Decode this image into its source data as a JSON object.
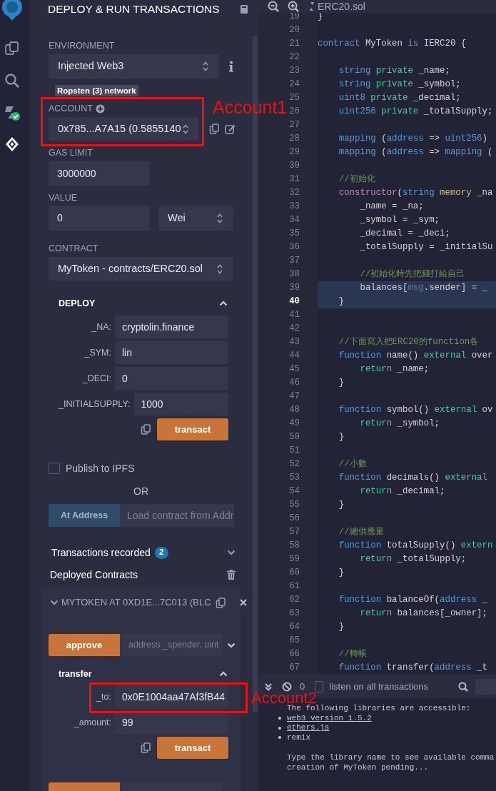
{
  "icon_bar": {
    "items": [
      {
        "kind": "files",
        "selected": false
      },
      {
        "kind": "search",
        "selected": false
      },
      {
        "kind": "compiler",
        "selected": false
      },
      {
        "kind": "deploy",
        "selected": true
      }
    ]
  },
  "panel": {
    "title": "DEPLOY & RUN TRANSACTIONS",
    "environment": {
      "label": "ENVIRONMENT",
      "value": "Injected Web3",
      "network": "Ropsten (3) network"
    },
    "account": {
      "label": "ACCOUNT",
      "value": "0x785...A7A15 (0.5855140"
    },
    "gas_limit": {
      "label": "GAS LIMIT",
      "value": "3000000"
    },
    "value": {
      "label": "VALUE",
      "amount": "0",
      "unit": "Wei"
    },
    "contract": {
      "label": "CONTRACT",
      "value": "MyToken - contracts/ERC20.sol"
    },
    "deploy": {
      "title": "DEPLOY",
      "expanded": true,
      "params": [
        {
          "label": "_NA:",
          "value": "cryptolin.finance"
        },
        {
          "label": "_SYM:",
          "value": "lin"
        },
        {
          "label": "_DECI:",
          "value": "0"
        },
        {
          "label": "_INITIALSUPPLY:",
          "value": "1000"
        }
      ],
      "button": "transact"
    },
    "publish_ipfs": {
      "label": "Publish to IPFS",
      "checked": false
    },
    "or": "OR",
    "at_address": {
      "button": "At Address",
      "placeholder": "Load contract from Addr"
    },
    "transactions_recorded": {
      "label": "Transactions recorded",
      "count": "2"
    },
    "deployed_contracts": {
      "title": "Deployed Contracts",
      "contracts": [
        {
          "title": "MYTOKEN AT 0XD1E...7C013 (BLC",
          "expanded": true,
          "functions": [
            {
              "label": "approve",
              "expanded": false,
              "placeholder": "address _spender, uint"
            },
            {
              "label": "transfer",
              "expanded": true,
              "params": [
                {
                  "label": "_to:",
                  "value": "0x0E1004aa47Af3fB44"
                },
                {
                  "label": "_amount:",
                  "value": "99"
                }
              ],
              "button": "transact"
            },
            {
              "expanded": false
            }
          ]
        }
      ]
    }
  },
  "editor": {
    "tab": "ERC20.sol",
    "lines": [
      {
        "number": "19",
        "highlighted": false,
        "current": false,
        "tokens": [
          {
            "text": "}",
            "kind": "plain"
          }
        ]
      },
      {
        "number": "20",
        "highlighted": false,
        "current": false
      },
      {
        "number": "21",
        "highlighted": false,
        "current": false,
        "tokens": [
          {
            "text": "contract",
            "kind": "keyword"
          },
          {
            "text": " MyToken ",
            "kind": "plain"
          },
          {
            "text": "is",
            "kind": "keyword"
          },
          {
            "text": " IERC20 {",
            "kind": "plain"
          }
        ]
      },
      {
        "number": "22",
        "highlighted": false,
        "current": false
      },
      {
        "number": "23",
        "highlighted": false,
        "current": false,
        "tokens": [
          {
            "text": "    string",
            "kind": "type"
          },
          {
            "text": " private",
            "kind": "modifier"
          },
          {
            "text": " _name;",
            "kind": "plain"
          }
        ]
      },
      {
        "number": "24",
        "highlighted": false,
        "current": false,
        "tokens": [
          {
            "text": "    string",
            "kind": "type"
          },
          {
            "text": " private",
            "kind": "modifier"
          },
          {
            "text": " _symbol;",
            "kind": "plain"
          }
        ]
      },
      {
        "number": "25",
        "highlighted": false,
        "current": false,
        "tokens": [
          {
            "text": "    uint8",
            "kind": "type"
          },
          {
            "text": " private",
            "kind": "modifier"
          },
          {
            "text": " _decimal;",
            "kind": "plain"
          }
        ]
      },
      {
        "number": "26",
        "highlighted": false,
        "current": false,
        "tokens": [
          {
            "text": "    uint256",
            "kind": "type"
          },
          {
            "text": " private",
            "kind": "modifier"
          },
          {
            "text": " _totalSupply;",
            "kind": "plain"
          }
        ]
      },
      {
        "number": "27",
        "highlighted": false,
        "current": false
      },
      {
        "number": "28",
        "highlighted": false,
        "current": false,
        "tokens": [
          {
            "text": "    mapping",
            "kind": "type"
          },
          {
            "text": " (",
            "kind": "plain"
          },
          {
            "text": "address",
            "kind": "type"
          },
          {
            "text": " => ",
            "kind": "plain"
          },
          {
            "text": "uint256",
            "kind": "type"
          },
          {
            "text": ")",
            "kind": "plain"
          }
        ]
      },
      {
        "number": "29",
        "highlighted": false,
        "current": false,
        "tokens": [
          {
            "text": "    mapping",
            "kind": "type"
          },
          {
            "text": " (",
            "kind": "plain"
          },
          {
            "text": "address",
            "kind": "type"
          },
          {
            "text": " => ",
            "kind": "plain"
          },
          {
            "text": "mapping",
            "kind": "type"
          },
          {
            "text": " (",
            "kind": "plain"
          }
        ]
      },
      {
        "number": "30",
        "highlighted": false,
        "current": false
      },
      {
        "number": "31",
        "highlighted": false,
        "current": false,
        "tokens": [
          {
            "text": "    //初始化",
            "kind": "comment"
          }
        ]
      },
      {
        "number": "32",
        "highlighted": false,
        "current": false,
        "tokens": [
          {
            "text": "    constructor",
            "kind": "special"
          },
          {
            "text": "(",
            "kind": "plain"
          },
          {
            "text": "string",
            "kind": "type"
          },
          {
            "text": " memory",
            "kind": "storage"
          },
          {
            "text": " _na",
            "kind": "plain"
          }
        ]
      },
      {
        "number": "33",
        "highlighted": false,
        "current": false,
        "tokens": [
          {
            "text": "        _name = _na;",
            "kind": "plain"
          }
        ]
      },
      {
        "number": "34",
        "highlighted": false,
        "current": false,
        "tokens": [
          {
            "text": "        _symbol = _sym;",
            "kind": "plain"
          }
        ]
      },
      {
        "number": "35",
        "highlighted": false,
        "current": false,
        "tokens": [
          {
            "text": "        _decimal = _deci;",
            "kind": "plain"
          }
        ]
      },
      {
        "number": "36",
        "highlighted": false,
        "current": false,
        "tokens": [
          {
            "text": "        _totalSupply = _initialSu",
            "kind": "plain"
          }
        ]
      },
      {
        "number": "37",
        "highlighted": false,
        "current": false
      },
      {
        "number": "38",
        "highlighted": false,
        "current": false,
        "tokens": [
          {
            "text": "        //初始化時先把錢打給自己",
            "kind": "comment"
          }
        ]
      },
      {
        "number": "39",
        "highlighted": true,
        "current": false,
        "tokens": [
          {
            "text": "        balances[",
            "kind": "plain"
          },
          {
            "text": "msg",
            "kind": "builtin"
          },
          {
            "text": ".sender] = _",
            "kind": "plain"
          }
        ]
      },
      {
        "number": "40",
        "highlighted": true,
        "current": true,
        "tokens": [
          {
            "text": "    }",
            "kind": "plain"
          }
        ]
      },
      {
        "number": "41",
        "highlighted": false,
        "current": false
      },
      {
        "number": "42",
        "highlighted": false,
        "current": false
      },
      {
        "number": "43",
        "highlighted": false,
        "current": false,
        "tokens": [
          {
            "text": "    //下面寫入把ERC20的function各",
            "kind": "comment"
          }
        ]
      },
      {
        "number": "44",
        "highlighted": false,
        "current": false,
        "tokens": [
          {
            "text": "    function",
            "kind": "keyword"
          },
          {
            "text": " name() ",
            "kind": "plain"
          },
          {
            "text": "external",
            "kind": "modifier"
          },
          {
            "text": " over",
            "kind": "plain"
          }
        ]
      },
      {
        "number": "45",
        "highlighted": false,
        "current": false,
        "tokens": [
          {
            "text": "        return",
            "kind": "modifier"
          },
          {
            "text": " _name;",
            "kind": "plain"
          }
        ]
      },
      {
        "number": "46",
        "highlighted": false,
        "current": false,
        "tokens": [
          {
            "text": "    }",
            "kind": "plain"
          }
        ]
      },
      {
        "number": "47",
        "highlighted": false,
        "current": false
      },
      {
        "number": "48",
        "highlighted": false,
        "current": false,
        "tokens": [
          {
            "text": "    function",
            "kind": "keyword"
          },
          {
            "text": " symbol() ",
            "kind": "plain"
          },
          {
            "text": "external",
            "kind": "modifier"
          },
          {
            "text": " ov",
            "kind": "plain"
          }
        ]
      },
      {
        "number": "49",
        "highlighted": false,
        "current": false,
        "tokens": [
          {
            "text": "        return",
            "kind": "modifier"
          },
          {
            "text": " _symbol;",
            "kind": "plain"
          }
        ]
      },
      {
        "number": "50",
        "highlighted": false,
        "current": false,
        "tokens": [
          {
            "text": "    }",
            "kind": "plain"
          }
        ]
      },
      {
        "number": "51",
        "highlighted": false,
        "current": false
      },
      {
        "number": "52",
        "highlighted": false,
        "current": false,
        "tokens": [
          {
            "text": "    //小數",
            "kind": "comment"
          }
        ]
      },
      {
        "number": "53",
        "highlighted": false,
        "current": false,
        "tokens": [
          {
            "text": "    function",
            "kind": "keyword"
          },
          {
            "text": " decimals() ",
            "kind": "plain"
          },
          {
            "text": "external",
            "kind": "modifier"
          }
        ]
      },
      {
        "number": "54",
        "highlighted": false,
        "current": false,
        "tokens": [
          {
            "text": "        return",
            "kind": "modifier"
          },
          {
            "text": " _decimal;",
            "kind": "plain"
          }
        ]
      },
      {
        "number": "55",
        "highlighted": false,
        "current": false,
        "tokens": [
          {
            "text": "    }",
            "kind": "plain"
          }
        ]
      },
      {
        "number": "56",
        "highlighted": false,
        "current": false
      },
      {
        "number": "57",
        "highlighted": false,
        "current": false,
        "tokens": [
          {
            "text": "    //總供應量",
            "kind": "comment"
          }
        ]
      },
      {
        "number": "58",
        "highlighted": false,
        "current": false,
        "tokens": [
          {
            "text": "    function",
            "kind": "keyword"
          },
          {
            "text": " totalSupply() ",
            "kind": "plain"
          },
          {
            "text": "extern",
            "kind": "modifier"
          }
        ]
      },
      {
        "number": "59",
        "highlighted": false,
        "current": false,
        "tokens": [
          {
            "text": "        return",
            "kind": "modifier"
          },
          {
            "text": " _totalSupply;",
            "kind": "plain"
          }
        ]
      },
      {
        "number": "60",
        "highlighted": false,
        "current": false,
        "tokens": [
          {
            "text": "    }",
            "kind": "plain"
          }
        ]
      },
      {
        "number": "61",
        "highlighted": false,
        "current": false
      },
      {
        "number": "62",
        "highlighted": false,
        "current": false,
        "tokens": [
          {
            "text": "    function",
            "kind": "keyword"
          },
          {
            "text": " balanceOf(",
            "kind": "plain"
          },
          {
            "text": "address",
            "kind": "type"
          },
          {
            "text": " _",
            "kind": "plain"
          }
        ]
      },
      {
        "number": "63",
        "highlighted": false,
        "current": false,
        "tokens": [
          {
            "text": "        return",
            "kind": "modifier"
          },
          {
            "text": " balances[_owner];",
            "kind": "plain"
          }
        ]
      },
      {
        "number": "64",
        "highlighted": false,
        "current": false,
        "tokens": [
          {
            "text": "    }",
            "kind": "plain"
          }
        ]
      },
      {
        "number": "65",
        "highlighted": false,
        "current": false
      },
      {
        "number": "66",
        "highlighted": false,
        "current": false,
        "tokens": [
          {
            "text": "    //轉帳",
            "kind": "comment"
          }
        ]
      },
      {
        "number": "67",
        "highlighted": false,
        "current": false,
        "tokens": [
          {
            "text": "    function",
            "kind": "keyword"
          },
          {
            "text": " transfer(",
            "kind": "plain"
          },
          {
            "text": "address",
            "kind": "type"
          },
          {
            "text": " _t",
            "kind": "plain"
          }
        ]
      }
    ]
  },
  "console": {
    "count": "0",
    "listen": {
      "label": "listen on all transactions",
      "checked": false
    },
    "lines": [
      {
        "kind": "text",
        "text": "The following libraries are accessible:"
      },
      {
        "kind": "bullet_link",
        "text": "web3 version 1.5.2"
      },
      {
        "kind": "bullet_link",
        "text": "ethers.js"
      },
      {
        "kind": "bullet",
        "text": "remix"
      },
      {
        "kind": "text",
        "text": "Type the library name to see available comma"
      },
      {
        "kind": "text",
        "text": "creation of MyToken pending..."
      }
    ]
  },
  "annotations": [
    {
      "label": "Account1"
    },
    {
      "label": "Account2"
    }
  ]
}
